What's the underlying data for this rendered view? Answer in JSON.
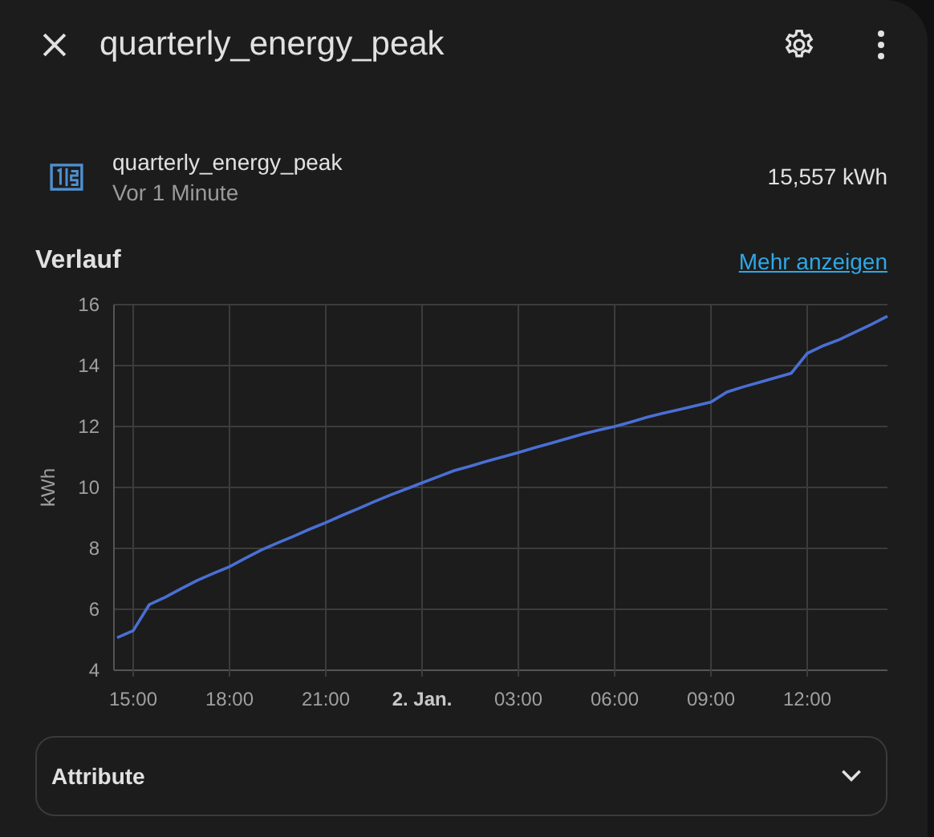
{
  "header": {
    "title": "quarterly_energy_peak"
  },
  "entity": {
    "name": "quarterly_energy_peak",
    "last_changed": "Vor 1 Minute",
    "state": "15,557 kWh"
  },
  "history": {
    "title": "Verlauf",
    "link": "Mehr anzeigen",
    "chart_data": {
      "type": "line",
      "grid": true,
      "ylabel": "kWh",
      "ylim": [
        4,
        16
      ],
      "yticks": [
        4,
        6,
        8,
        10,
        12,
        14,
        16
      ],
      "categories": [
        null,
        "15:00",
        null,
        null,
        null,
        null,
        null,
        "18:00",
        null,
        null,
        null,
        null,
        null,
        "21:00",
        null,
        null,
        null,
        null,
        null,
        "2. Jan.",
        null,
        null,
        null,
        null,
        null,
        "03:00",
        null,
        null,
        null,
        null,
        null,
        "06:00",
        null,
        null,
        null,
        null,
        null,
        "09:00",
        null,
        null,
        null,
        null,
        null,
        "12:00",
        null,
        null,
        null,
        null,
        null
      ],
      "series": [
        {
          "color": "#4a6fd4",
          "values": [
            5.07,
            5.3,
            6.15,
            6.4,
            6.68,
            6.95,
            7.18,
            7.4,
            7.68,
            7.95,
            8.18,
            8.4,
            8.63,
            8.85,
            9.08,
            9.3,
            9.53,
            9.75,
            9.95,
            10.15,
            10.35,
            10.55,
            10.7,
            10.85,
            11.0,
            11.15,
            11.3,
            11.45,
            11.6,
            11.75,
            11.88,
            12.0,
            12.15,
            12.3,
            12.43,
            12.55,
            12.68,
            12.8,
            13.13,
            13.3,
            13.45,
            13.6,
            13.75,
            14.4,
            14.65,
            14.85,
            15.1,
            15.35,
            15.62
          ]
        }
      ]
    }
  },
  "attributes": {
    "title": "Attribute",
    "expanded": false
  }
}
